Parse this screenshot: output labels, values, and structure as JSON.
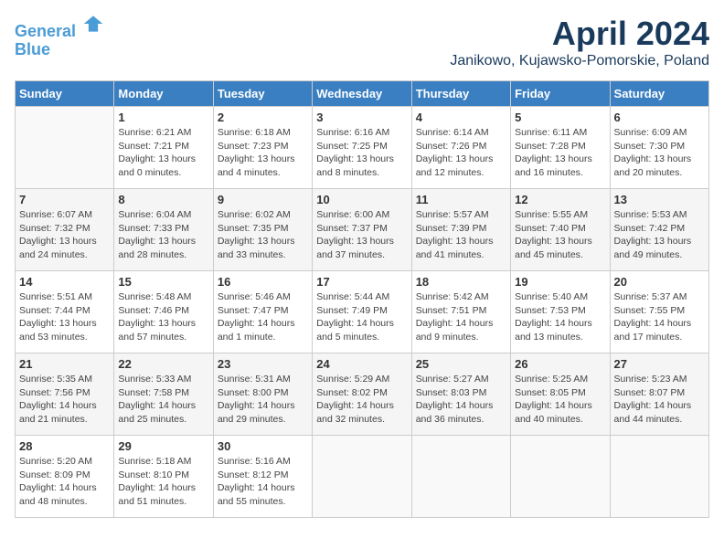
{
  "header": {
    "logo_line1": "General",
    "logo_line2": "Blue",
    "month_title": "April 2024",
    "location": "Janikowo, Kujawsko-Pomorskie, Poland"
  },
  "weekdays": [
    "Sunday",
    "Monday",
    "Tuesday",
    "Wednesday",
    "Thursday",
    "Friday",
    "Saturday"
  ],
  "weeks": [
    [
      {
        "day": "",
        "info": ""
      },
      {
        "day": "1",
        "info": "Sunrise: 6:21 AM\nSunset: 7:21 PM\nDaylight: 13 hours\nand 0 minutes."
      },
      {
        "day": "2",
        "info": "Sunrise: 6:18 AM\nSunset: 7:23 PM\nDaylight: 13 hours\nand 4 minutes."
      },
      {
        "day": "3",
        "info": "Sunrise: 6:16 AM\nSunset: 7:25 PM\nDaylight: 13 hours\nand 8 minutes."
      },
      {
        "day": "4",
        "info": "Sunrise: 6:14 AM\nSunset: 7:26 PM\nDaylight: 13 hours\nand 12 minutes."
      },
      {
        "day": "5",
        "info": "Sunrise: 6:11 AM\nSunset: 7:28 PM\nDaylight: 13 hours\nand 16 minutes."
      },
      {
        "day": "6",
        "info": "Sunrise: 6:09 AM\nSunset: 7:30 PM\nDaylight: 13 hours\nand 20 minutes."
      }
    ],
    [
      {
        "day": "7",
        "info": "Sunrise: 6:07 AM\nSunset: 7:32 PM\nDaylight: 13 hours\nand 24 minutes."
      },
      {
        "day": "8",
        "info": "Sunrise: 6:04 AM\nSunset: 7:33 PM\nDaylight: 13 hours\nand 28 minutes."
      },
      {
        "day": "9",
        "info": "Sunrise: 6:02 AM\nSunset: 7:35 PM\nDaylight: 13 hours\nand 33 minutes."
      },
      {
        "day": "10",
        "info": "Sunrise: 6:00 AM\nSunset: 7:37 PM\nDaylight: 13 hours\nand 37 minutes."
      },
      {
        "day": "11",
        "info": "Sunrise: 5:57 AM\nSunset: 7:39 PM\nDaylight: 13 hours\nand 41 minutes."
      },
      {
        "day": "12",
        "info": "Sunrise: 5:55 AM\nSunset: 7:40 PM\nDaylight: 13 hours\nand 45 minutes."
      },
      {
        "day": "13",
        "info": "Sunrise: 5:53 AM\nSunset: 7:42 PM\nDaylight: 13 hours\nand 49 minutes."
      }
    ],
    [
      {
        "day": "14",
        "info": "Sunrise: 5:51 AM\nSunset: 7:44 PM\nDaylight: 13 hours\nand 53 minutes."
      },
      {
        "day": "15",
        "info": "Sunrise: 5:48 AM\nSunset: 7:46 PM\nDaylight: 13 hours\nand 57 minutes."
      },
      {
        "day": "16",
        "info": "Sunrise: 5:46 AM\nSunset: 7:47 PM\nDaylight: 14 hours\nand 1 minute."
      },
      {
        "day": "17",
        "info": "Sunrise: 5:44 AM\nSunset: 7:49 PM\nDaylight: 14 hours\nand 5 minutes."
      },
      {
        "day": "18",
        "info": "Sunrise: 5:42 AM\nSunset: 7:51 PM\nDaylight: 14 hours\nand 9 minutes."
      },
      {
        "day": "19",
        "info": "Sunrise: 5:40 AM\nSunset: 7:53 PM\nDaylight: 14 hours\nand 13 minutes."
      },
      {
        "day": "20",
        "info": "Sunrise: 5:37 AM\nSunset: 7:55 PM\nDaylight: 14 hours\nand 17 minutes."
      }
    ],
    [
      {
        "day": "21",
        "info": "Sunrise: 5:35 AM\nSunset: 7:56 PM\nDaylight: 14 hours\nand 21 minutes."
      },
      {
        "day": "22",
        "info": "Sunrise: 5:33 AM\nSunset: 7:58 PM\nDaylight: 14 hours\nand 25 minutes."
      },
      {
        "day": "23",
        "info": "Sunrise: 5:31 AM\nSunset: 8:00 PM\nDaylight: 14 hours\nand 29 minutes."
      },
      {
        "day": "24",
        "info": "Sunrise: 5:29 AM\nSunset: 8:02 PM\nDaylight: 14 hours\nand 32 minutes."
      },
      {
        "day": "25",
        "info": "Sunrise: 5:27 AM\nSunset: 8:03 PM\nDaylight: 14 hours\nand 36 minutes."
      },
      {
        "day": "26",
        "info": "Sunrise: 5:25 AM\nSunset: 8:05 PM\nDaylight: 14 hours\nand 40 minutes."
      },
      {
        "day": "27",
        "info": "Sunrise: 5:23 AM\nSunset: 8:07 PM\nDaylight: 14 hours\nand 44 minutes."
      }
    ],
    [
      {
        "day": "28",
        "info": "Sunrise: 5:20 AM\nSunset: 8:09 PM\nDaylight: 14 hours\nand 48 minutes."
      },
      {
        "day": "29",
        "info": "Sunrise: 5:18 AM\nSunset: 8:10 PM\nDaylight: 14 hours\nand 51 minutes."
      },
      {
        "day": "30",
        "info": "Sunrise: 5:16 AM\nSunset: 8:12 PM\nDaylight: 14 hours\nand 55 minutes."
      },
      {
        "day": "",
        "info": ""
      },
      {
        "day": "",
        "info": ""
      },
      {
        "day": "",
        "info": ""
      },
      {
        "day": "",
        "info": ""
      }
    ]
  ]
}
